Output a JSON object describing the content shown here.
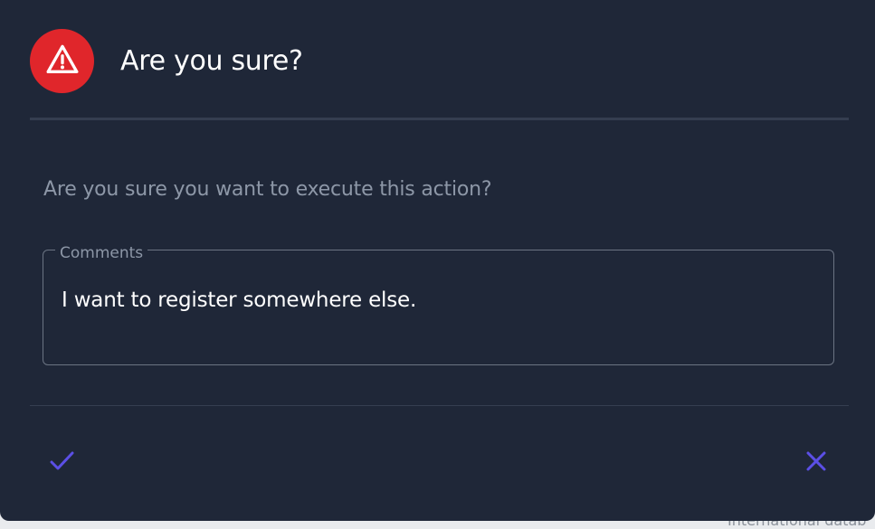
{
  "background": {
    "partial_text": "International datab"
  },
  "dialog": {
    "title": "Are you sure?",
    "message": "Are you sure you want to execute this action?",
    "icon": "warning-triangle-icon",
    "comments": {
      "label": "Comments",
      "value": "I want to register somewhere else."
    },
    "actions": {
      "confirm_icon": "check-icon",
      "cancel_icon": "close-icon"
    }
  },
  "colors": {
    "dialog_bg": "#1f2738",
    "alert_red": "#e0262b",
    "accent_purple": "#5b4fe6",
    "muted_text": "#8d97a7"
  }
}
